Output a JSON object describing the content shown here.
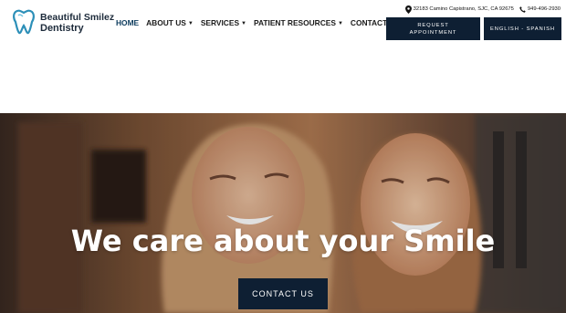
{
  "header": {
    "logo_line1": "Beautiful Smilez",
    "logo_line2": "Dentistry",
    "nav": [
      {
        "label": "HOME"
      },
      {
        "label": "ABOUT US"
      },
      {
        "label": "SERVICES"
      },
      {
        "label": "PATIENT RESOURCES"
      },
      {
        "label": "CONTACT US"
      }
    ],
    "address": "32183 Camino Capistrano, SJC, CA 92675",
    "phone": "949-496-2930",
    "request_line1": "REQUEST",
    "request_line2": "APPOINTMENT",
    "language": "ENGLISH - SPANISH"
  },
  "hero": {
    "title": "We care about your Smile",
    "button": "CONTACT US"
  },
  "colors": {
    "navy": "#0e1f33",
    "accent": "#0b3a5c"
  }
}
